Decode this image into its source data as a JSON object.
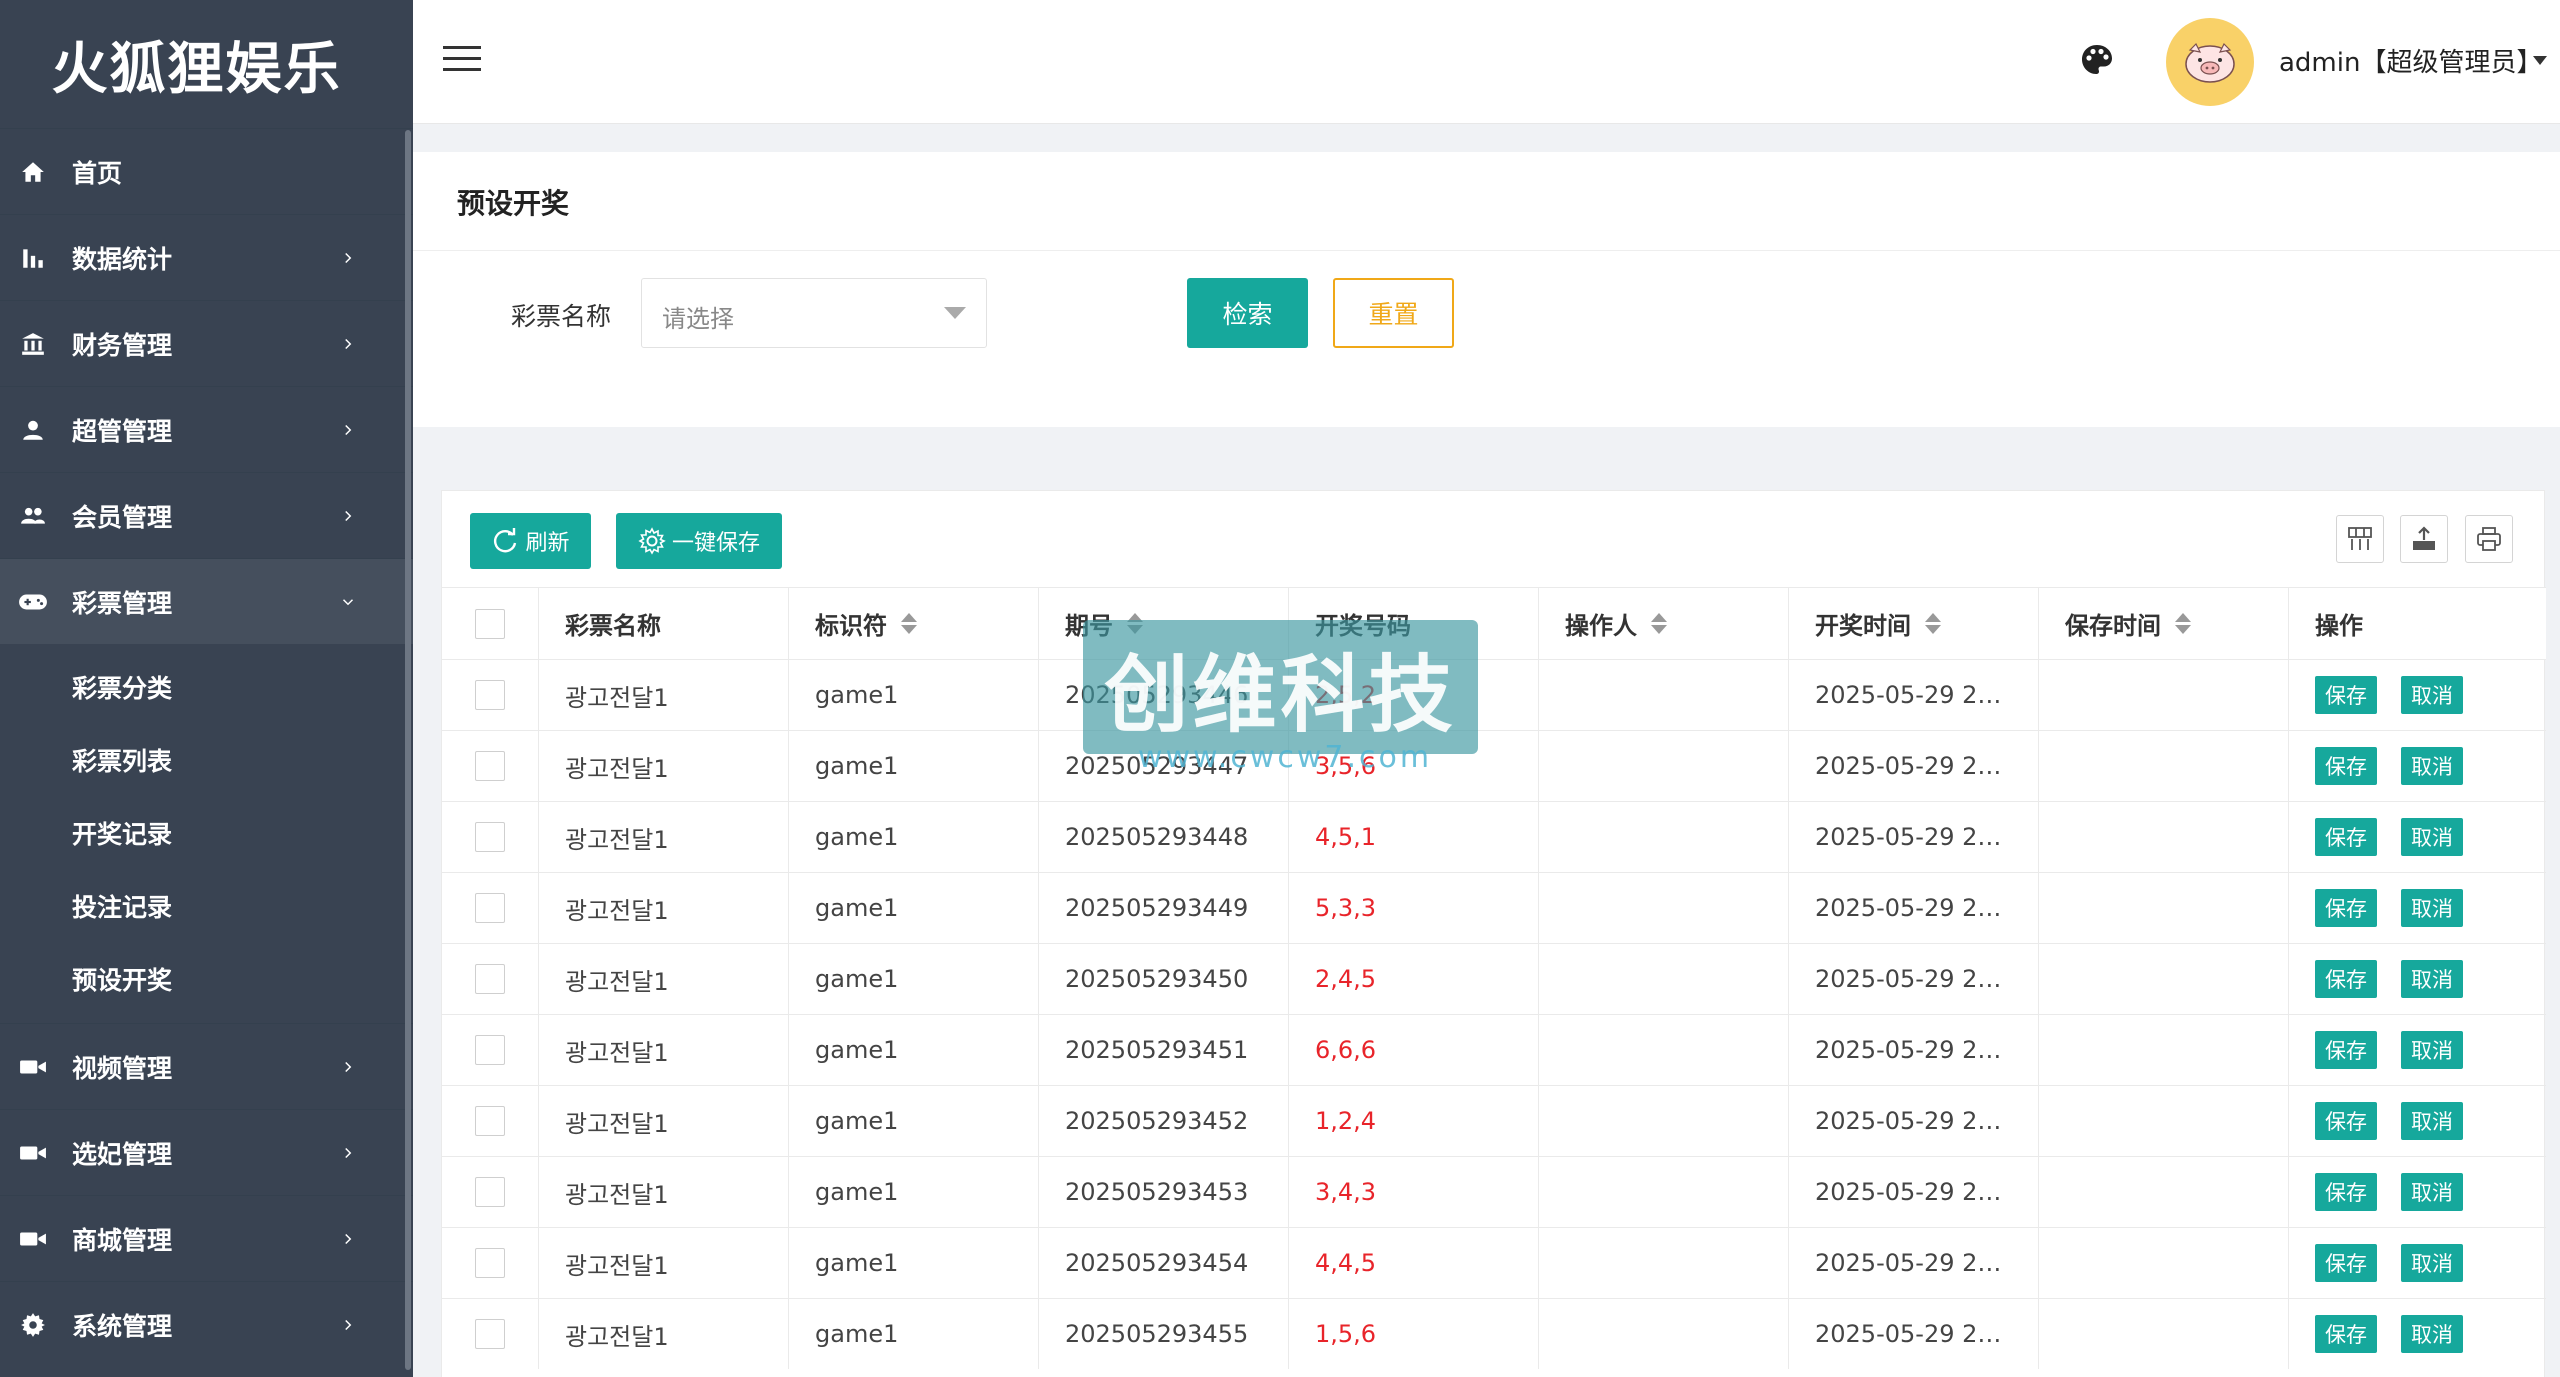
{
  "brand": "火狐狸娱乐",
  "sidebar": {
    "items": [
      {
        "label": "首页",
        "icon": "home-icon"
      },
      {
        "label": "数据统计",
        "icon": "bar-chart-icon"
      },
      {
        "label": "财务管理",
        "icon": "bank-icon"
      },
      {
        "label": "超管管理",
        "icon": "user-icon"
      },
      {
        "label": "会员管理",
        "icon": "users-icon"
      },
      {
        "label": "彩票管理",
        "icon": "gamepad-icon"
      }
    ],
    "submenu": [
      "彩票分类",
      "彩票列表",
      "开奖记录",
      "投注记录",
      "预设开奖"
    ],
    "items_after": [
      {
        "label": "视频管理",
        "icon": "video-icon"
      },
      {
        "label": "选妃管理",
        "icon": "video-icon"
      },
      {
        "label": "商城管理",
        "icon": "video-icon"
      },
      {
        "label": "系统管理",
        "icon": "gear-icon"
      }
    ]
  },
  "header": {
    "user": "admin【超级管理员】"
  },
  "filter": {
    "title": "预设开奖",
    "field_label": "彩票名称",
    "placeholder": "请选择",
    "search_label": "检索",
    "reset_label": "重置"
  },
  "toolbar": {
    "refresh_label": "刷新",
    "save_all_label": "一键保存"
  },
  "table": {
    "columns": [
      "彩票名称",
      "标识符",
      "期号",
      "开奖号码",
      "操作人",
      "开奖时间",
      "保存时间",
      "操作"
    ],
    "save_label": "保存",
    "cancel_label": "取消",
    "rows": [
      {
        "name": "광고전달1",
        "tag": "game1",
        "issue": "202505293446",
        "numbers": "2,5,2",
        "operator": "",
        "open_time": "2025-05-29 2…",
        "save_time": ""
      },
      {
        "name": "광고전달1",
        "tag": "game1",
        "issue": "202505293447",
        "numbers": "3,5,6",
        "operator": "",
        "open_time": "2025-05-29 2…",
        "save_time": ""
      },
      {
        "name": "광고전달1",
        "tag": "game1",
        "issue": "202505293448",
        "numbers": "4,5,1",
        "operator": "",
        "open_time": "2025-05-29 2…",
        "save_time": ""
      },
      {
        "name": "광고전달1",
        "tag": "game1",
        "issue": "202505293449",
        "numbers": "5,3,3",
        "operator": "",
        "open_time": "2025-05-29 2…",
        "save_time": ""
      },
      {
        "name": "광고전달1",
        "tag": "game1",
        "issue": "202505293450",
        "numbers": "2,4,5",
        "operator": "",
        "open_time": "2025-05-29 2…",
        "save_time": ""
      },
      {
        "name": "광고전달1",
        "tag": "game1",
        "issue": "202505293451",
        "numbers": "6,6,6",
        "operator": "",
        "open_time": "2025-05-29 2…",
        "save_time": ""
      },
      {
        "name": "광고전달1",
        "tag": "game1",
        "issue": "202505293452",
        "numbers": "1,2,4",
        "operator": "",
        "open_time": "2025-05-29 2…",
        "save_time": ""
      },
      {
        "name": "광고전달1",
        "tag": "game1",
        "issue": "202505293453",
        "numbers": "3,4,3",
        "operator": "",
        "open_time": "2025-05-29 2…",
        "save_time": ""
      },
      {
        "name": "광고전달1",
        "tag": "game1",
        "issue": "202505293454",
        "numbers": "4,4,5",
        "operator": "",
        "open_time": "2025-05-29 2…",
        "save_time": ""
      },
      {
        "name": "광고전달1",
        "tag": "game1",
        "issue": "202505293455",
        "numbers": "1,5,6",
        "operator": "",
        "open_time": "2025-05-29 2…",
        "save_time": ""
      }
    ]
  },
  "watermark": {
    "text": "创维科技",
    "url": "www.cwcw7.com"
  },
  "colors": {
    "sidebar_bg": "#394352",
    "accent": "#16a89c",
    "reset": "#f0a818",
    "number_red": "#e8242a"
  }
}
